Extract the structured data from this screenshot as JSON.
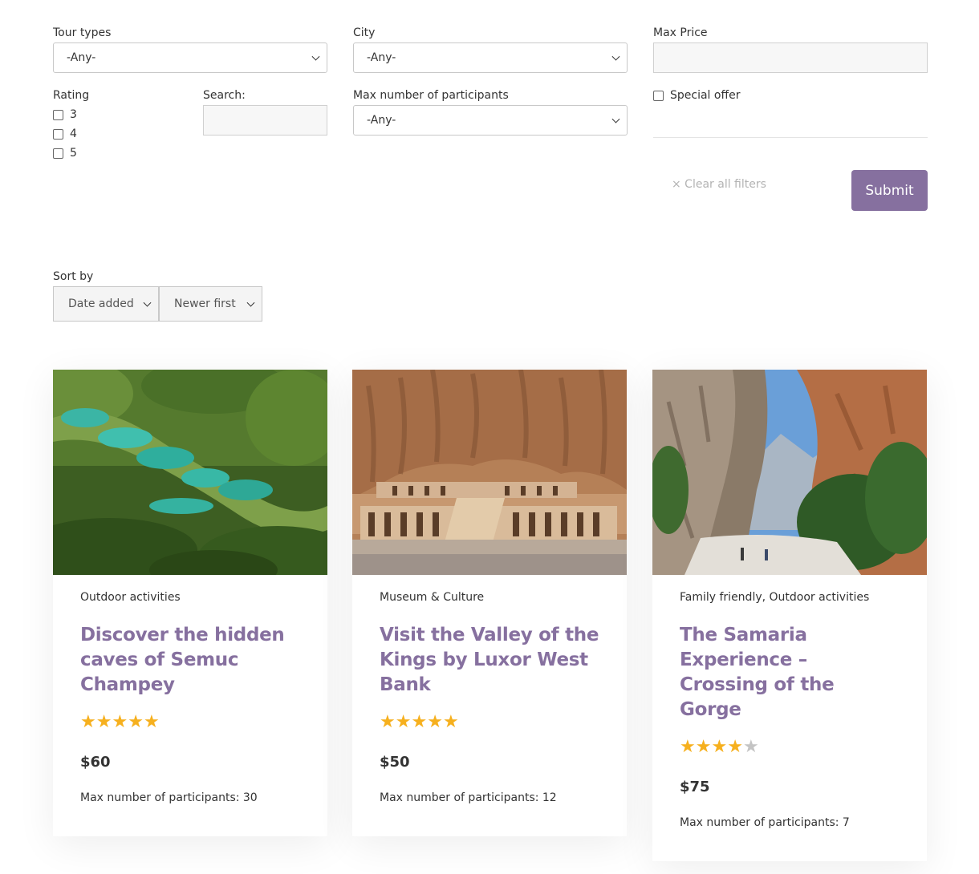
{
  "filters": {
    "tour_types": {
      "label": "Tour types",
      "value": "-Any-"
    },
    "city": {
      "label": "City",
      "value": "-Any-"
    },
    "max_price": {
      "label": "Max Price",
      "value": ""
    },
    "rating": {
      "label": "Rating",
      "options": [
        "3",
        "4",
        "5"
      ]
    },
    "search": {
      "label": "Search:",
      "value": ""
    },
    "max_participants": {
      "label": "Max number of participants",
      "value": "-Any-"
    },
    "special_offer": {
      "label": "Special offer"
    },
    "clear_label": "× Clear all filters",
    "submit_label": "Submit"
  },
  "sort": {
    "label": "Sort by",
    "field": "Date added",
    "order": "Newer first"
  },
  "tours": [
    {
      "category": "Outdoor activities",
      "title": "Discover the hidden caves of Semuc Champey",
      "rating": 5,
      "price": "$60",
      "participants": "Max number of participants: 30",
      "image": "jungle-pools"
    },
    {
      "category": "Museum & Culture",
      "title": "Visit the Valley of the Kings by Luxor West Bank",
      "rating": 5,
      "price": "$50",
      "participants": "Max number of participants: 12",
      "image": "temple-cliffs"
    },
    {
      "category": "Family friendly, Outdoor activities",
      "title": "The Samaria Experience – Crossing of the Gorge",
      "rating": 4,
      "price": "$75",
      "participants": "Max number of participants: 7",
      "image": "gorge-canyon"
    }
  ],
  "colors": {
    "accent": "#86709f",
    "star": "#f6b01e",
    "star_empty": "#c4c4c4"
  }
}
